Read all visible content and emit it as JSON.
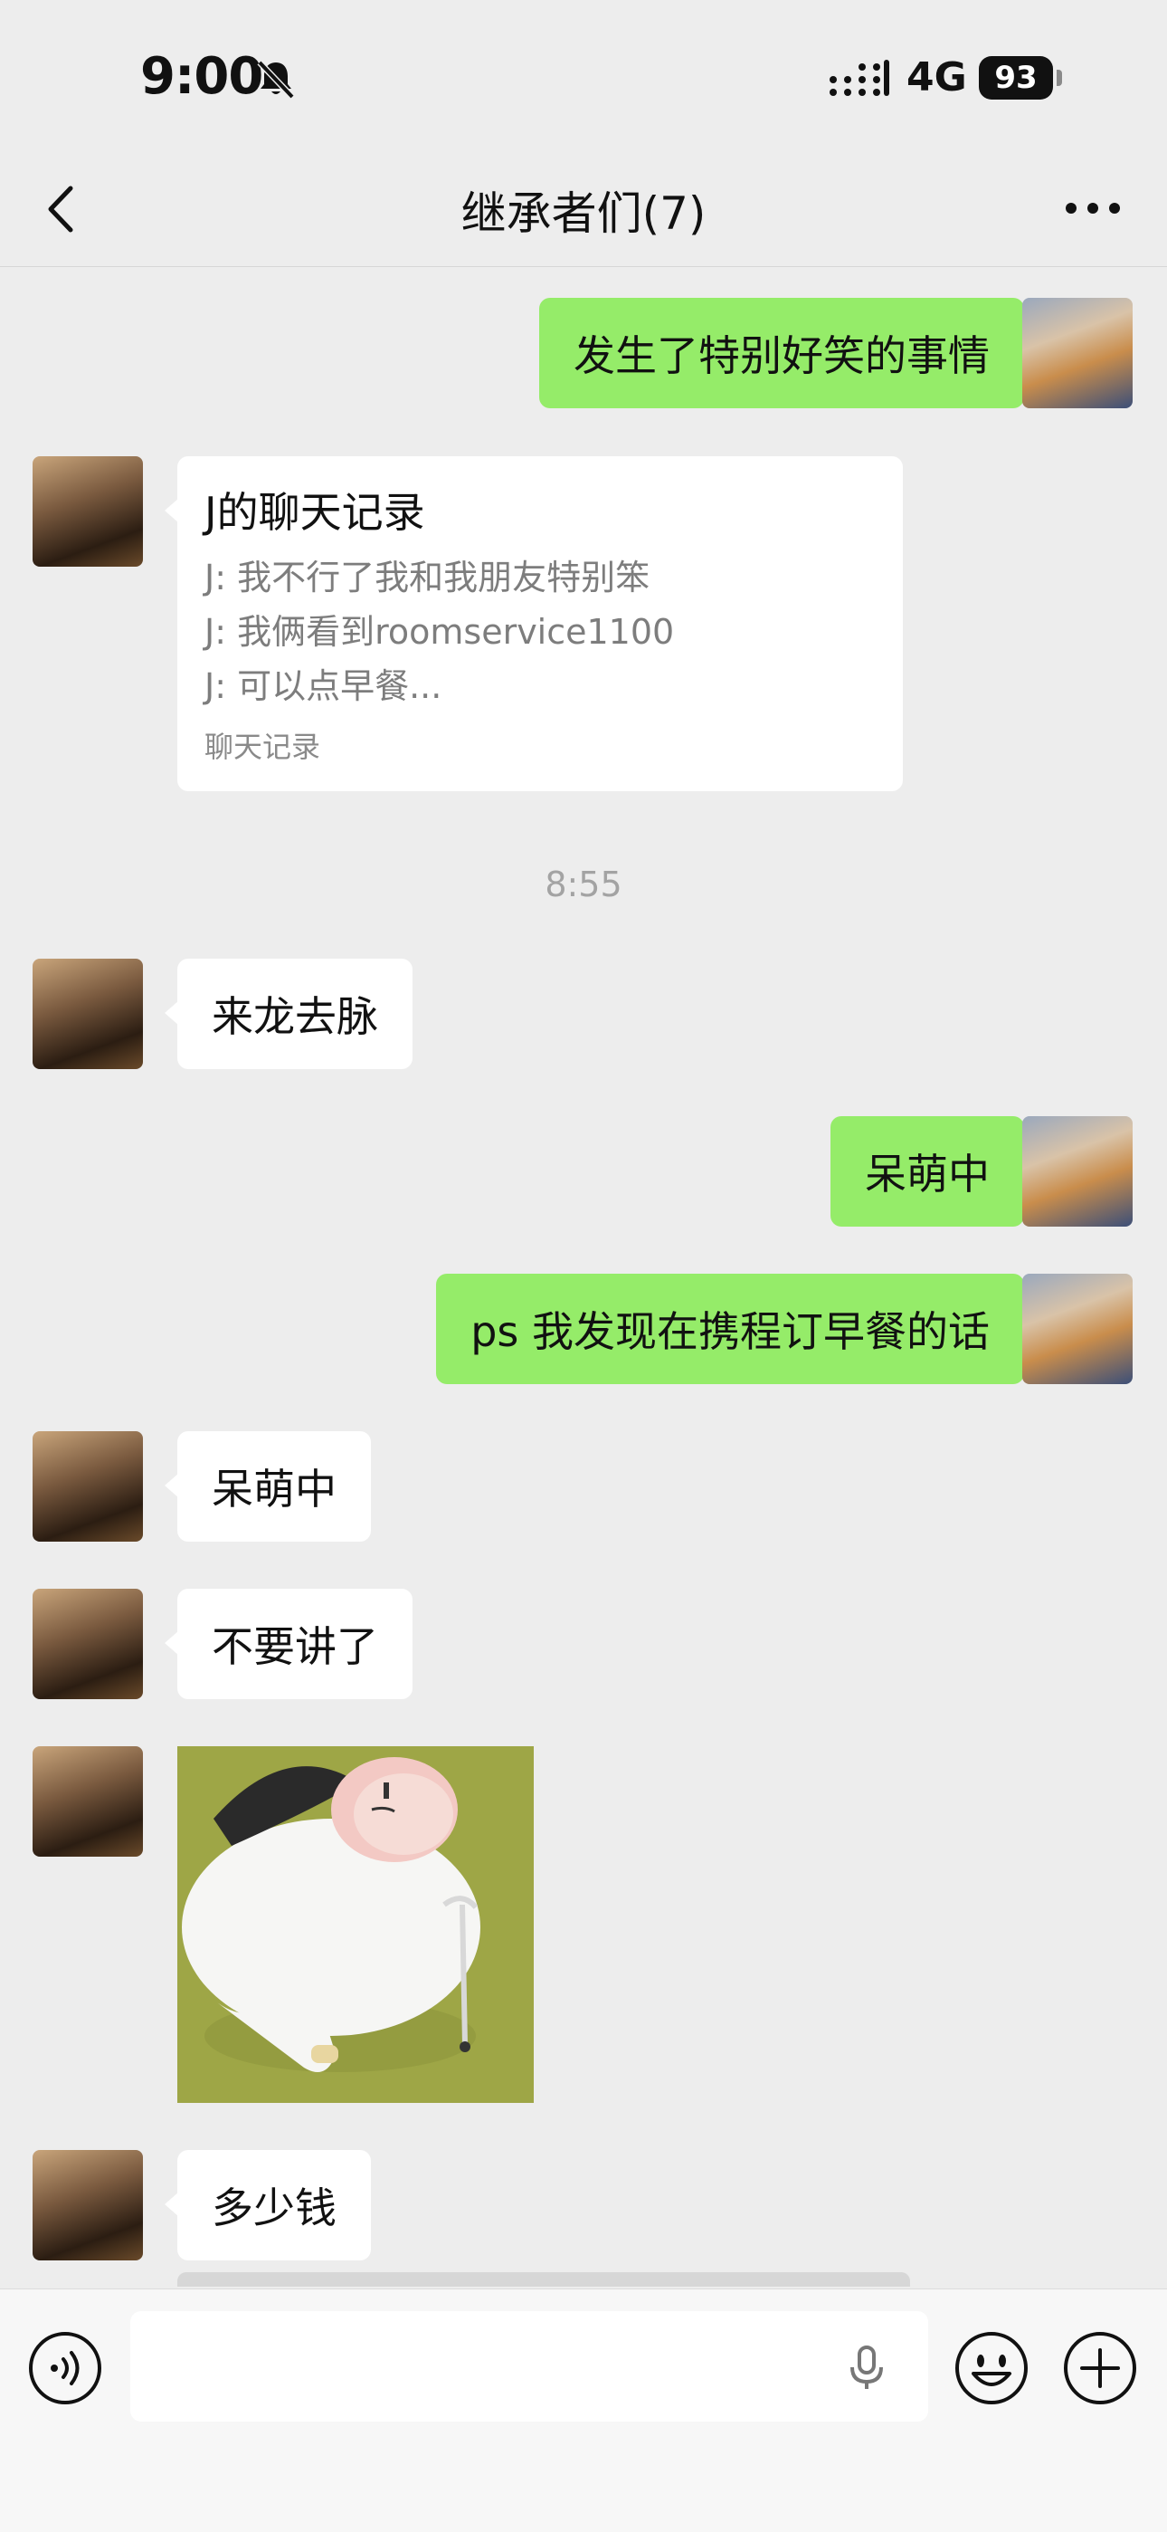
{
  "status": {
    "time": "9:00",
    "network": "4G",
    "battery": "93"
  },
  "nav": {
    "title": "继承者们(7)"
  },
  "messages": [
    {
      "side": "right",
      "text": "发生了特别好笑的事情"
    },
    {
      "side": "left",
      "type": "chat-record",
      "title": "J的聊天记录",
      "lines": [
        "J: 我不行了我和我朋友特别笨",
        "J: 我俩看到roomservice1100",
        "J: 可以点早餐..."
      ],
      "footer": "聊天记录"
    },
    {
      "type": "timestamp",
      "text": "8:55"
    },
    {
      "side": "left",
      "text": "来龙去脉"
    },
    {
      "side": "right",
      "text": "呆萌中"
    },
    {
      "side": "right",
      "text": "ps 我发现在携程订早餐的话"
    },
    {
      "side": "left",
      "text": "呆萌中"
    },
    {
      "side": "left",
      "text": "不要讲了"
    },
    {
      "side": "left",
      "type": "sticker",
      "icon": "cow-with-cane-sticker"
    },
    {
      "side": "left",
      "text": "多少钱"
    }
  ],
  "input": {
    "value": "",
    "placeholder": ""
  },
  "colors": {
    "background": "#ededed",
    "outgoing_bubble": "#95ec69",
    "incoming_bubble": "#ffffff"
  }
}
